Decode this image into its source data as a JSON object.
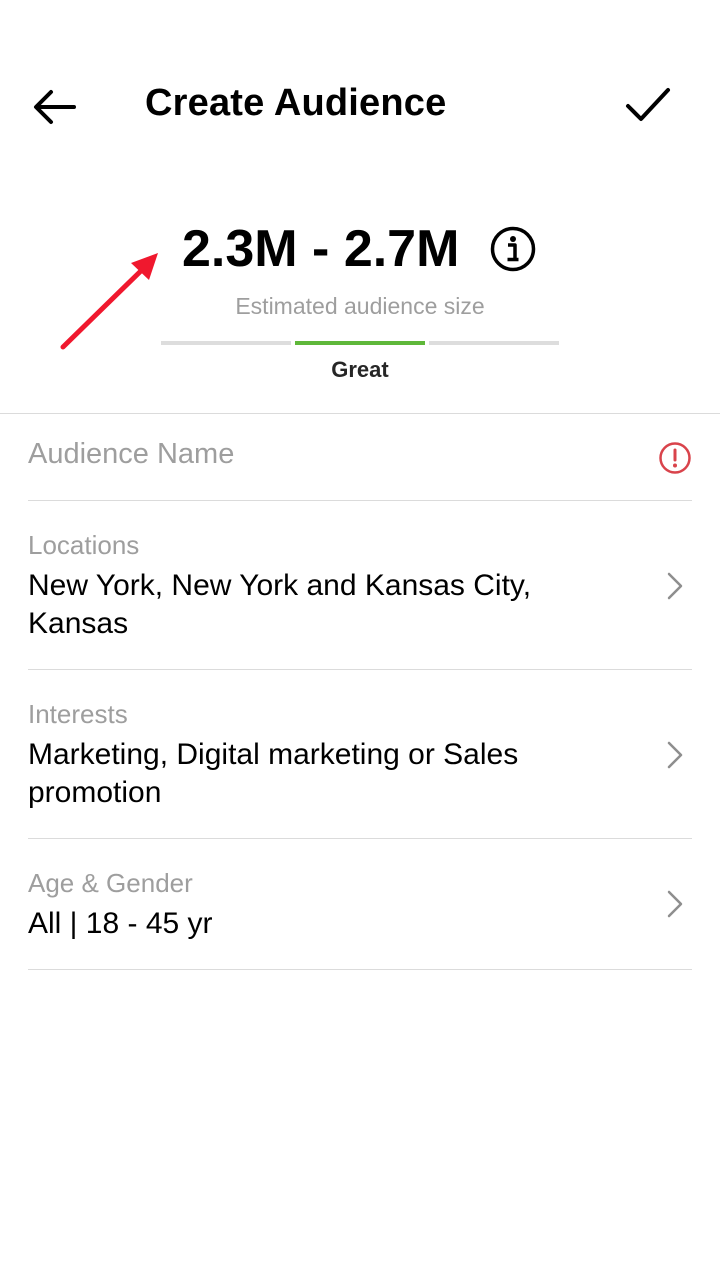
{
  "header": {
    "title": "Create Audience",
    "back_icon": "arrow-left-icon",
    "confirm_icon": "checkmark-icon"
  },
  "estimate": {
    "range": "2.3M - 2.7M",
    "caption": "Estimated audience size",
    "quality_label": "Great",
    "meter_active_segment": 2,
    "meter_total_segments": 3,
    "meter_active_color": "#5fb83a",
    "info_icon": "info-circle-icon"
  },
  "annotation": {
    "icon": "red-arrow-annotation",
    "color": "#f0182e"
  },
  "form": {
    "audience_name": {
      "placeholder": "Audience Name",
      "status_icon": "alert-circle-icon",
      "status_color": "#d9434b"
    },
    "locations": {
      "label": "Locations",
      "value": "New York, New York and Kansas City, Kansas"
    },
    "interests": {
      "label": "Interests",
      "value": "Marketing, Digital marketing or Sales promotion"
    },
    "age_gender": {
      "label": "Age & Gender",
      "value": "All | 18 - 45 yr"
    },
    "chevron_icon": "chevron-right-icon"
  }
}
